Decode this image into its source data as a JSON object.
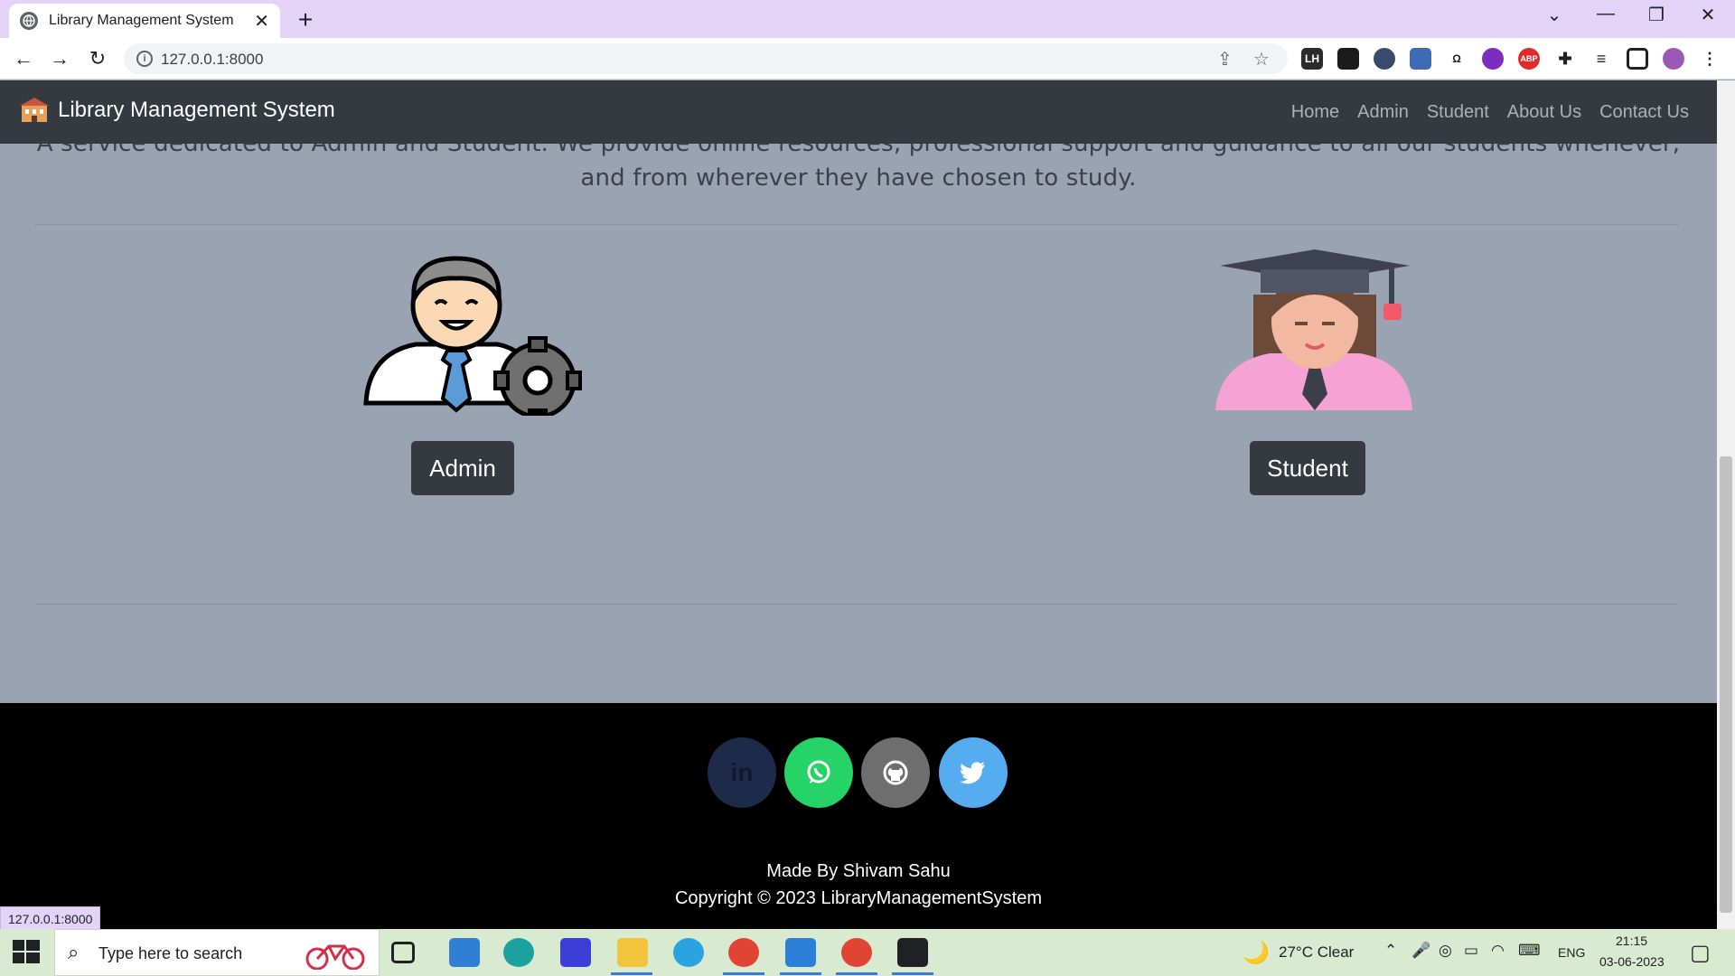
{
  "browser": {
    "tab_title": "Library Management System",
    "url": "127.0.0.1:8000",
    "extensions": [
      "LH",
      "ABP"
    ],
    "status_url": "127.0.0.1:8000"
  },
  "navbar": {
    "brand": "Library Management System",
    "links": [
      "Home",
      "Admin",
      "Student",
      "About Us",
      "Contact Us"
    ]
  },
  "hero": {
    "tagline": "A service dedicated to Admin and Student. We provide online resources, professional support and guidance to all our students whenever, and from wherever they have chosen to study."
  },
  "roles": {
    "admin_label": "Admin",
    "student_label": "Student"
  },
  "footer": {
    "social": [
      "linkedin",
      "whatsapp",
      "github",
      "twitter"
    ],
    "made_by": "Made By Shivam Sahu",
    "copyright": "Copyright © 2023 LibraryManagementSystem"
  },
  "taskbar": {
    "search_placeholder": "Type here to search",
    "weather": "27°C  Clear",
    "lang": "ENG",
    "time": "21:15",
    "date": "03-06-2023"
  },
  "colors": {
    "navbar": "#343a40",
    "page_bg": "#9aa3b2",
    "footer": "#000000",
    "linkedin": "#1e2a4a",
    "whatsapp": "#25d366",
    "github": "#6e6e6e",
    "twitter": "#55acee"
  }
}
